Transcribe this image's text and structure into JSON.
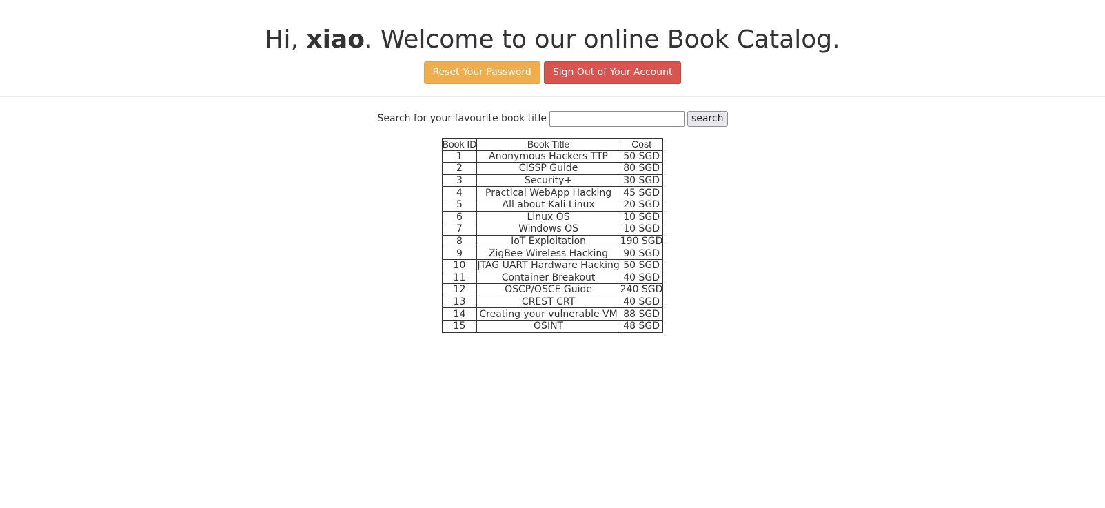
{
  "header": {
    "greeting": "Hi, ",
    "username": "xiao",
    "welcome": ". Welcome to our online Book Catalog.",
    "reset_label": "Reset Your Password",
    "signout_label": "Sign Out of Your Account"
  },
  "search": {
    "label": "Search for your favourite book title",
    "value": "",
    "button": "search"
  },
  "table": {
    "headers": [
      "Book ID",
      "Book Title",
      "Cost"
    ],
    "rows": [
      [
        "1",
        "Anonymous Hackers TTP",
        "50 SGD"
      ],
      [
        "2",
        "CISSP Guide",
        "80 SGD"
      ],
      [
        "3",
        "Security+",
        "30 SGD"
      ],
      [
        "4",
        "Practical WebApp Hacking",
        "45 SGD"
      ],
      [
        "5",
        "All about Kali Linux",
        "20 SGD"
      ],
      [
        "6",
        "Linux OS",
        "10 SGD"
      ],
      [
        "7",
        "Windows OS",
        "10 SGD"
      ],
      [
        "8",
        "IoT Exploitation",
        "190 SGD"
      ],
      [
        "9",
        "ZigBee Wireless Hacking",
        "90 SGD"
      ],
      [
        "10",
        "JTAG UART Hardware Hacking",
        "50 SGD"
      ],
      [
        "11",
        "Container Breakout",
        "40 SGD"
      ],
      [
        "12",
        "OSCP/OSCE Guide",
        "240 SGD"
      ],
      [
        "13",
        "CREST CRT",
        "40 SGD"
      ],
      [
        "14",
        "Creating your vulnerable VM",
        "88 SGD"
      ],
      [
        "15",
        "OSINT",
        "48 SGD"
      ]
    ]
  }
}
